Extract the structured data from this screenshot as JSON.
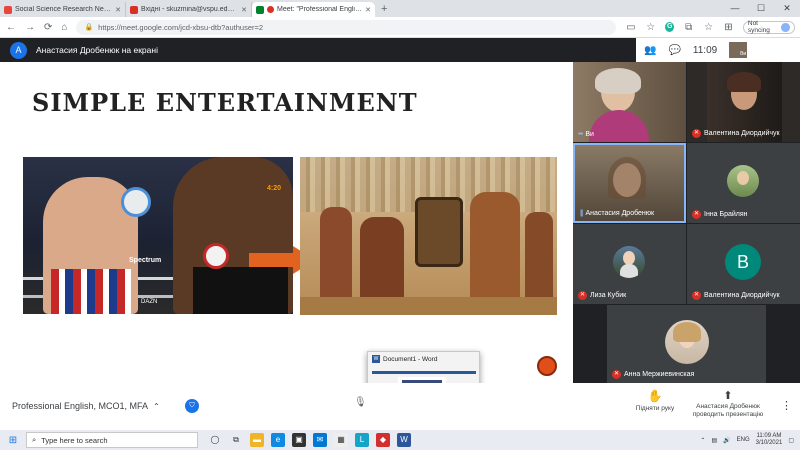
{
  "browser": {
    "tabs": [
      {
        "title": "Social Science Research Network",
        "fav_color": "#e8453c"
      },
      {
        "title": "Вхідні - skuzmina@vspu.edu.ua",
        "fav_color": "#d93025"
      },
      {
        "title": "Meet: \"Professional English",
        "fav_color": "#00832d"
      }
    ],
    "new_tab": "+",
    "url": "https://meet.google.com/jcd-xbsu-dtb?authuser=2",
    "sync_label": "Not syncing"
  },
  "meet": {
    "presenter_initial": "А",
    "presenter_banner": "Анастасия Дробенюк на екрані",
    "clock": "11:09",
    "self_mini_label": "Ви",
    "meeting_name": "Professional English, MCO1, MFA",
    "raise_hand_label": "Підняти руку",
    "presenting_label": "Анастасия Дробенюк проводить презентацію"
  },
  "slide": {
    "title": "Simple Entertainment",
    "boxing_sponsor": "Spectrum",
    "boxing_score": "4:20",
    "boxing_brand": "DAZN"
  },
  "participants": [
    {
      "name": "Ви",
      "muted": false,
      "speaking": true
    },
    {
      "name": "Валентина Диордийчук",
      "muted": true,
      "speaking": false
    },
    {
      "name": "Анастасия Дробенюк",
      "muted": false,
      "speaking": true
    },
    {
      "name": "Інна Брайлян",
      "muted": true,
      "speaking": false
    },
    {
      "name": "Лиза Кубик",
      "muted": true,
      "speaking": false
    },
    {
      "name": "Валентина Диордийчук",
      "muted": true,
      "speaking": false,
      "avatar_letter": "В"
    },
    {
      "name": "Анна Мержиевинская",
      "muted": true,
      "speaking": false
    }
  ],
  "word_popup": {
    "title": "Document1 - Word"
  },
  "taskbar": {
    "search_placeholder": "Type here to search",
    "lang": "ENG",
    "time": "11:09 AM",
    "date": "3/10/2021"
  },
  "colors": {
    "meet_bg": "#202124",
    "accent_blue": "#1a73e8",
    "mic_off_red": "#d93025",
    "arrow_orange": "#e2631f"
  }
}
